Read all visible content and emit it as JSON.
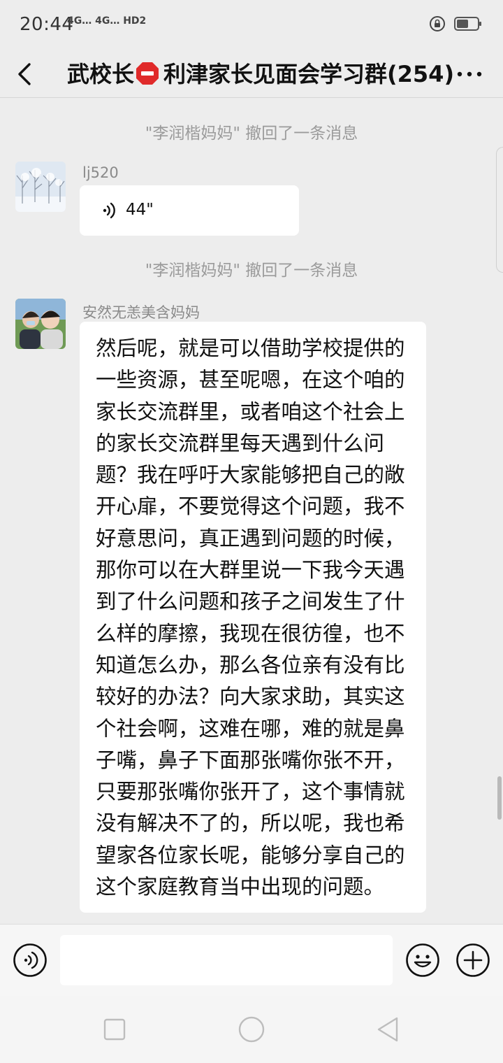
{
  "status_bar": {
    "time": "20:44",
    "signal": "4G… 4G… HD2",
    "icons": [
      "lock-rotation-icon",
      "battery-icon"
    ]
  },
  "header": {
    "title_prefix": "武校长",
    "title_icon": "stop-sign-icon",
    "title_suffix": "利津家长见面会学习群(254)",
    "back_icon": "back-arrow-icon",
    "more_icon": "more-dots-icon"
  },
  "messages": {
    "system_1": "\"李润楷妈妈\" 撤回了一条消息",
    "voice_msg": {
      "sender": "lj520",
      "duration": "44\"",
      "avatar": "snowy-trees-avatar"
    },
    "system_2": "\"李润楷妈妈\" 撤回了一条消息",
    "text_msg": {
      "sender": "安然无恙美含妈妈",
      "avatar": "family-photo-avatar",
      "text": "然后呢，就是可以借助学校提供的一些资源，甚至呢嗯，在这个咱的家长交流群里，或者咱这个社会上的家长交流群里每天遇到什么问题？我在呼吁大家能够把自己的敞开心扉，不要觉得这个问题，我不好意思问，真正遇到问题的时候，那你可以在大群里说一下我今天遇到了什么问题和孩子之间发生了什么样的摩擦，我现在很彷徨，也不知道怎么办，那么各位亲有没有比较好的办法？向大家求助，其实这个社会啊，这难在哪，难的就是鼻子嘴，鼻子下面那张嘴你张不开，只要那张嘴你张开了，这个事情就没有解决不了的，所以呢，我也希望家各位家长呢，能够分享自己的这个家庭教育当中出现的问题。"
    }
  },
  "input_bar": {
    "placeholder": "",
    "icons": [
      "voice-toggle-icon",
      "emoji-icon",
      "add-icon"
    ]
  },
  "nav_bar": {
    "icons": [
      "recents-icon",
      "home-icon",
      "back-icon"
    ]
  },
  "colors": {
    "background": "#ededed",
    "bubble": "#ffffff",
    "system_text": "#9b9b9b",
    "stop_sign": "#e02a2a"
  }
}
